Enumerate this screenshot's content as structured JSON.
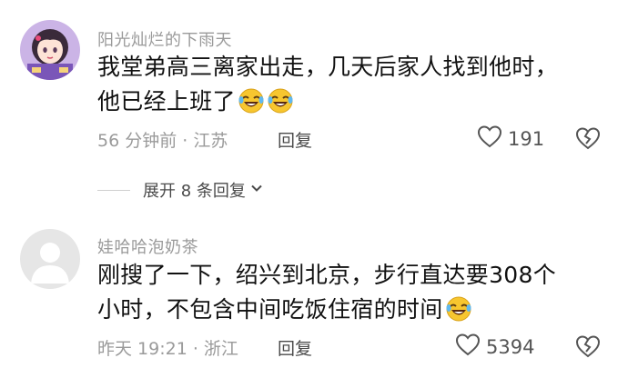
{
  "comments": [
    {
      "username": "阳光灿烂的下雨天",
      "line1": "我堂弟高三离家出走，几天后家人找到他时，",
      "line2": "他已经上班了",
      "meta": "56 分钟前 · 江苏",
      "reply": "回复",
      "likes": "191",
      "emoji_count": 2
    },
    {
      "username": "娃哈哈泡奶茶",
      "line1": "刚搜了一下，绍兴到北京，步行直达要308个",
      "line2": "小时，不包含中间吃饭住宿的时间",
      "meta": "昨天 19:21 · 浙江",
      "reply": "回复",
      "likes": "5394",
      "emoji_count": 1
    }
  ],
  "expand_replies": "展开 8 条回复",
  "icons": {
    "like": "heart-outline-icon",
    "dislike": "broken-heart-icon",
    "expand": "chevron-down-icon",
    "emoji": "rofl-emoji-icon"
  }
}
